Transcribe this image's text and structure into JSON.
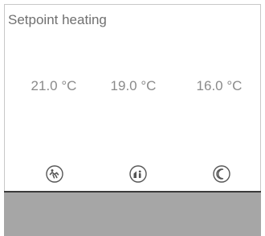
{
  "header": {
    "title": "Setpoint heating"
  },
  "setpoints": [
    {
      "value": "21.0 °C",
      "icon": "comfort-icon"
    },
    {
      "value": "19.0 °C",
      "icon": "standby-icon"
    },
    {
      "value": "16.0 °C",
      "icon": "night-icon"
    }
  ],
  "colors": {
    "text": "#707070",
    "value_text": "#8a8a8a",
    "footer": "#a6a6a6",
    "footer_border": "#3a3a3a",
    "panel_border": "#c8c8c8"
  }
}
